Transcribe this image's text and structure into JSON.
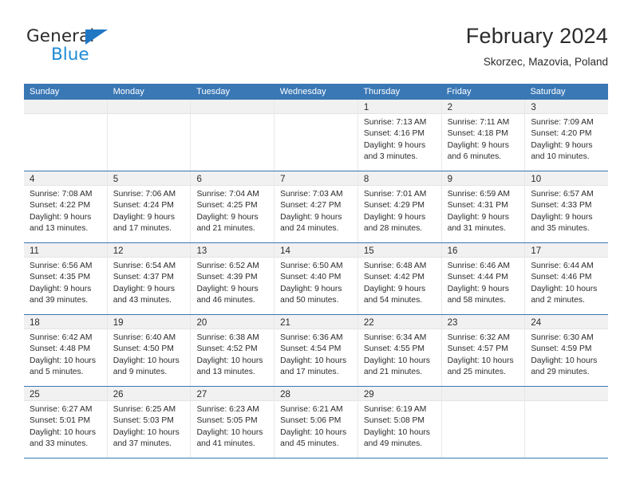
{
  "brand": {
    "name_part1": "General",
    "name_part2": "Blue",
    "accent_color": "#1f8ad4",
    "triangle_color": "#1f77c4"
  },
  "header": {
    "title": "February 2024",
    "subtitle": "Skorzec, Mazovia, Poland",
    "header_bg_color": "#3a78b5"
  },
  "weekdays": [
    "Sunday",
    "Monday",
    "Tuesday",
    "Wednesday",
    "Thursday",
    "Friday",
    "Saturday"
  ],
  "weeks": [
    [
      {
        "day": "",
        "empty": true,
        "sunrise": "",
        "sunset": "",
        "daylight1": "",
        "daylight2": ""
      },
      {
        "day": "",
        "empty": true,
        "sunrise": "",
        "sunset": "",
        "daylight1": "",
        "daylight2": ""
      },
      {
        "day": "",
        "empty": true,
        "sunrise": "",
        "sunset": "",
        "daylight1": "",
        "daylight2": ""
      },
      {
        "day": "",
        "empty": true,
        "sunrise": "",
        "sunset": "",
        "daylight1": "",
        "daylight2": ""
      },
      {
        "day": "1",
        "empty": false,
        "sunrise": "Sunrise: 7:13 AM",
        "sunset": "Sunset: 4:16 PM",
        "daylight1": "Daylight: 9 hours",
        "daylight2": "and 3 minutes."
      },
      {
        "day": "2",
        "empty": false,
        "sunrise": "Sunrise: 7:11 AM",
        "sunset": "Sunset: 4:18 PM",
        "daylight1": "Daylight: 9 hours",
        "daylight2": "and 6 minutes."
      },
      {
        "day": "3",
        "empty": false,
        "sunrise": "Sunrise: 7:09 AM",
        "sunset": "Sunset: 4:20 PM",
        "daylight1": "Daylight: 9 hours",
        "daylight2": "and 10 minutes."
      }
    ],
    [
      {
        "day": "4",
        "empty": false,
        "sunrise": "Sunrise: 7:08 AM",
        "sunset": "Sunset: 4:22 PM",
        "daylight1": "Daylight: 9 hours",
        "daylight2": "and 13 minutes."
      },
      {
        "day": "5",
        "empty": false,
        "sunrise": "Sunrise: 7:06 AM",
        "sunset": "Sunset: 4:24 PM",
        "daylight1": "Daylight: 9 hours",
        "daylight2": "and 17 minutes."
      },
      {
        "day": "6",
        "empty": false,
        "sunrise": "Sunrise: 7:04 AM",
        "sunset": "Sunset: 4:25 PM",
        "daylight1": "Daylight: 9 hours",
        "daylight2": "and 21 minutes."
      },
      {
        "day": "7",
        "empty": false,
        "sunrise": "Sunrise: 7:03 AM",
        "sunset": "Sunset: 4:27 PM",
        "daylight1": "Daylight: 9 hours",
        "daylight2": "and 24 minutes."
      },
      {
        "day": "8",
        "empty": false,
        "sunrise": "Sunrise: 7:01 AM",
        "sunset": "Sunset: 4:29 PM",
        "daylight1": "Daylight: 9 hours",
        "daylight2": "and 28 minutes."
      },
      {
        "day": "9",
        "empty": false,
        "sunrise": "Sunrise: 6:59 AM",
        "sunset": "Sunset: 4:31 PM",
        "daylight1": "Daylight: 9 hours",
        "daylight2": "and 31 minutes."
      },
      {
        "day": "10",
        "empty": false,
        "sunrise": "Sunrise: 6:57 AM",
        "sunset": "Sunset: 4:33 PM",
        "daylight1": "Daylight: 9 hours",
        "daylight2": "and 35 minutes."
      }
    ],
    [
      {
        "day": "11",
        "empty": false,
        "sunrise": "Sunrise: 6:56 AM",
        "sunset": "Sunset: 4:35 PM",
        "daylight1": "Daylight: 9 hours",
        "daylight2": "and 39 minutes."
      },
      {
        "day": "12",
        "empty": false,
        "sunrise": "Sunrise: 6:54 AM",
        "sunset": "Sunset: 4:37 PM",
        "daylight1": "Daylight: 9 hours",
        "daylight2": "and 43 minutes."
      },
      {
        "day": "13",
        "empty": false,
        "sunrise": "Sunrise: 6:52 AM",
        "sunset": "Sunset: 4:39 PM",
        "daylight1": "Daylight: 9 hours",
        "daylight2": "and 46 minutes."
      },
      {
        "day": "14",
        "empty": false,
        "sunrise": "Sunrise: 6:50 AM",
        "sunset": "Sunset: 4:40 PM",
        "daylight1": "Daylight: 9 hours",
        "daylight2": "and 50 minutes."
      },
      {
        "day": "15",
        "empty": false,
        "sunrise": "Sunrise: 6:48 AM",
        "sunset": "Sunset: 4:42 PM",
        "daylight1": "Daylight: 9 hours",
        "daylight2": "and 54 minutes."
      },
      {
        "day": "16",
        "empty": false,
        "sunrise": "Sunrise: 6:46 AM",
        "sunset": "Sunset: 4:44 PM",
        "daylight1": "Daylight: 9 hours",
        "daylight2": "and 58 minutes."
      },
      {
        "day": "17",
        "empty": false,
        "sunrise": "Sunrise: 6:44 AM",
        "sunset": "Sunset: 4:46 PM",
        "daylight1": "Daylight: 10 hours",
        "daylight2": "and 2 minutes."
      }
    ],
    [
      {
        "day": "18",
        "empty": false,
        "sunrise": "Sunrise: 6:42 AM",
        "sunset": "Sunset: 4:48 PM",
        "daylight1": "Daylight: 10 hours",
        "daylight2": "and 5 minutes."
      },
      {
        "day": "19",
        "empty": false,
        "sunrise": "Sunrise: 6:40 AM",
        "sunset": "Sunset: 4:50 PM",
        "daylight1": "Daylight: 10 hours",
        "daylight2": "and 9 minutes."
      },
      {
        "day": "20",
        "empty": false,
        "sunrise": "Sunrise: 6:38 AM",
        "sunset": "Sunset: 4:52 PM",
        "daylight1": "Daylight: 10 hours",
        "daylight2": "and 13 minutes."
      },
      {
        "day": "21",
        "empty": false,
        "sunrise": "Sunrise: 6:36 AM",
        "sunset": "Sunset: 4:54 PM",
        "daylight1": "Daylight: 10 hours",
        "daylight2": "and 17 minutes."
      },
      {
        "day": "22",
        "empty": false,
        "sunrise": "Sunrise: 6:34 AM",
        "sunset": "Sunset: 4:55 PM",
        "daylight1": "Daylight: 10 hours",
        "daylight2": "and 21 minutes."
      },
      {
        "day": "23",
        "empty": false,
        "sunrise": "Sunrise: 6:32 AM",
        "sunset": "Sunset: 4:57 PM",
        "daylight1": "Daylight: 10 hours",
        "daylight2": "and 25 minutes."
      },
      {
        "day": "24",
        "empty": false,
        "sunrise": "Sunrise: 6:30 AM",
        "sunset": "Sunset: 4:59 PM",
        "daylight1": "Daylight: 10 hours",
        "daylight2": "and 29 minutes."
      }
    ],
    [
      {
        "day": "25",
        "empty": false,
        "sunrise": "Sunrise: 6:27 AM",
        "sunset": "Sunset: 5:01 PM",
        "daylight1": "Daylight: 10 hours",
        "daylight2": "and 33 minutes."
      },
      {
        "day": "26",
        "empty": false,
        "sunrise": "Sunrise: 6:25 AM",
        "sunset": "Sunset: 5:03 PM",
        "daylight1": "Daylight: 10 hours",
        "daylight2": "and 37 minutes."
      },
      {
        "day": "27",
        "empty": false,
        "sunrise": "Sunrise: 6:23 AM",
        "sunset": "Sunset: 5:05 PM",
        "daylight1": "Daylight: 10 hours",
        "daylight2": "and 41 minutes."
      },
      {
        "day": "28",
        "empty": false,
        "sunrise": "Sunrise: 6:21 AM",
        "sunset": "Sunset: 5:06 PM",
        "daylight1": "Daylight: 10 hours",
        "daylight2": "and 45 minutes."
      },
      {
        "day": "29",
        "empty": false,
        "sunrise": "Sunrise: 6:19 AM",
        "sunset": "Sunset: 5:08 PM",
        "daylight1": "Daylight: 10 hours",
        "daylight2": "and 49 minutes."
      },
      {
        "day": "",
        "empty": true,
        "sunrise": "",
        "sunset": "",
        "daylight1": "",
        "daylight2": ""
      },
      {
        "day": "",
        "empty": true,
        "sunrise": "",
        "sunset": "",
        "daylight1": "",
        "daylight2": ""
      }
    ]
  ]
}
